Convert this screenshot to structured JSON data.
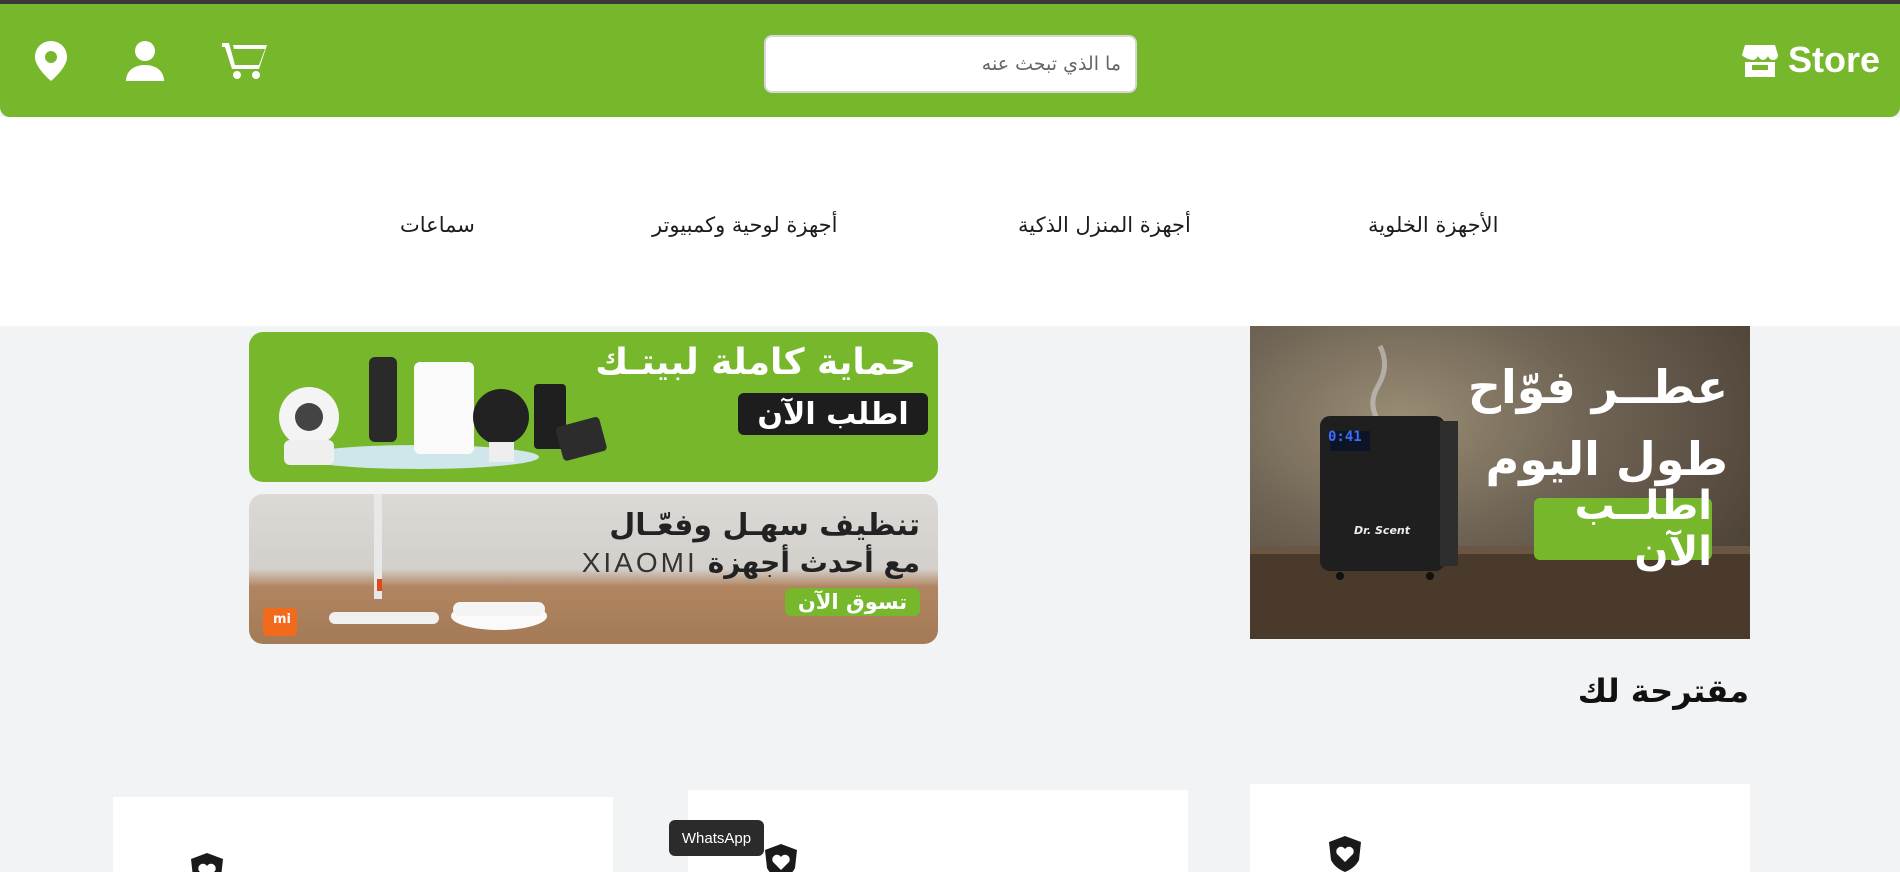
{
  "header": {
    "brand": "Store",
    "search_placeholder": "ما الذي تبحث عنه",
    "icons": [
      "location-icon",
      "user-icon",
      "cart-icon",
      "store-icon"
    ]
  },
  "nav": {
    "items": [
      {
        "label": "الأجهزة الخلوية"
      },
      {
        "label": "أجهزة المنزل الذكية"
      },
      {
        "label": "أجهزة لوحية وكمبيوتر"
      },
      {
        "label": "سماعات"
      }
    ]
  },
  "banners": {
    "security": {
      "headline": "حماية كاملة لبيتـك",
      "cta": "اطلب الآن"
    },
    "cleaning": {
      "line1": "تنظيف سهـل وفعّـال",
      "line2": "مع أحدث أجهزة",
      "brand": "XIAOMI",
      "cta": "تسوق الآن",
      "mi": "mi"
    },
    "scent": {
      "line1": "عطــر فوّاح",
      "line2": "طول اليوم",
      "cta": "اطلــب الآن",
      "display": "0:41",
      "device_logo": "Dr. Scent"
    }
  },
  "suggested": {
    "title": "مقترحة لك"
  },
  "whatsapp": {
    "label": "WhatsApp"
  },
  "colors": {
    "brand_green": "#77b72c",
    "dark": "#2b2b2b",
    "page_bg": "#f2f3f5"
  }
}
